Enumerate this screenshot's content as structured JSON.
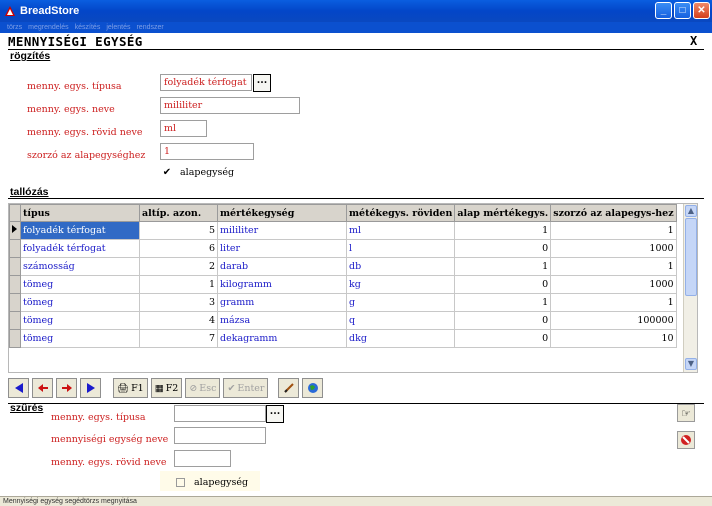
{
  "window": {
    "title": "BreadStore"
  },
  "menu": [
    "törzs",
    "megrendelés",
    "készítés",
    "jelentés",
    "rendszer"
  ],
  "form": {
    "title": "MENNYISÉGI EGYSÉG",
    "close_label": "X"
  },
  "entry": {
    "section": "rögzítés",
    "type_label": "menny. egys. típusa",
    "type_value": "folyadék térfogat",
    "name_label": "menny. egys. neve",
    "name_value": "mililiter",
    "short_label": "menny. egys. rövid neve",
    "short_value": "ml",
    "factor_label": "szorzó az alapegységhez",
    "factor_value": "1",
    "base_checkbox": "alapegység",
    "base_checked": true,
    "ellipsis": "..."
  },
  "browse": {
    "section": "tallózás",
    "columns": [
      "típus",
      "altíp. azon.",
      "mértékegység",
      "métékegys. röviden",
      "alap mértékegys.",
      "szorzó az alapegys-hez"
    ],
    "rows": [
      [
        "folyadék térfogat",
        "5",
        "mililiter",
        "ml",
        "1",
        "1"
      ],
      [
        "folyadék térfogat",
        "6",
        "liter",
        "l",
        "0",
        "1000"
      ],
      [
        "számosság",
        "2",
        "darab",
        "db",
        "1",
        "1"
      ],
      [
        "tömeg",
        "1",
        "kilogramm",
        "kg",
        "0",
        "1000"
      ],
      [
        "tömeg",
        "3",
        "gramm",
        "g",
        "1",
        "1"
      ],
      [
        "tömeg",
        "4",
        "mázsa",
        "q",
        "0",
        "100000"
      ],
      [
        "tömeg",
        "7",
        "dekagramm",
        "dkg",
        "0",
        "10"
      ]
    ],
    "selected_row": 0
  },
  "toolbar": {
    "f1": "F1",
    "f2": "F2",
    "esc": "Esc",
    "enter": "Enter"
  },
  "filter": {
    "section": "szűrés",
    "type_label": "menny. egys. típusa",
    "name_label": "mennyiségi egység neve",
    "short_label": "menny. egys. rövid neve",
    "base_checkbox": "alapegység",
    "ellipsis": "..."
  },
  "status": "Mennyiségi egység segédtörzs megnyitása",
  "colors": {
    "title_blue": "#0346c8",
    "label_red": "#cc1f1f",
    "select_blue": "#316ac5"
  }
}
